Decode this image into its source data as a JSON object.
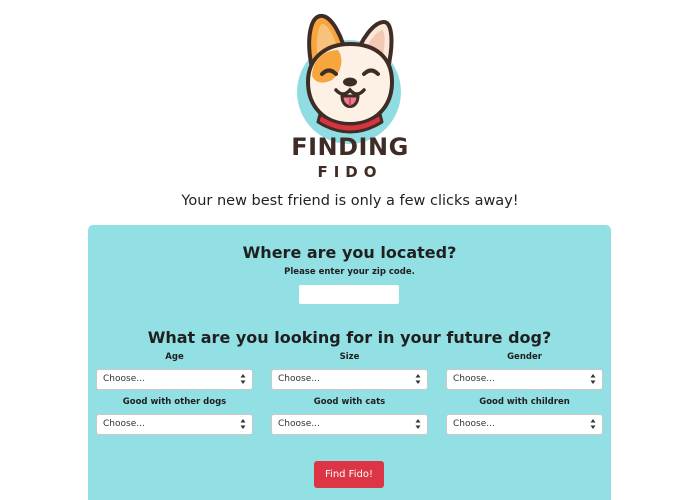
{
  "brand": {
    "title": "FINDING",
    "subtitle": "FIDO",
    "logo_icon": "french-bulldog-logo",
    "circle_color": "#8fdde3"
  },
  "tagline": "Your new best friend is only a few clicks away!",
  "location": {
    "heading": "Where are you located?",
    "zip_label": "Please enter your zip code.",
    "zip_value": ""
  },
  "preferences": {
    "heading": "What are you looking for in your future dog?",
    "fields": [
      {
        "label": "Age",
        "value": "Choose..."
      },
      {
        "label": "Size",
        "value": "Choose..."
      },
      {
        "label": "Gender",
        "value": "Choose..."
      },
      {
        "label": "Good with other dogs",
        "value": "Choose..."
      },
      {
        "label": "Good with cats",
        "value": "Choose..."
      },
      {
        "label": "Good with children",
        "value": "Choose..."
      }
    ]
  },
  "actions": {
    "find_label": "Find Fido!",
    "find_color": "#dc3545"
  },
  "colors": {
    "panel": "#92dfe4",
    "brand_text": "#3f2c25"
  }
}
